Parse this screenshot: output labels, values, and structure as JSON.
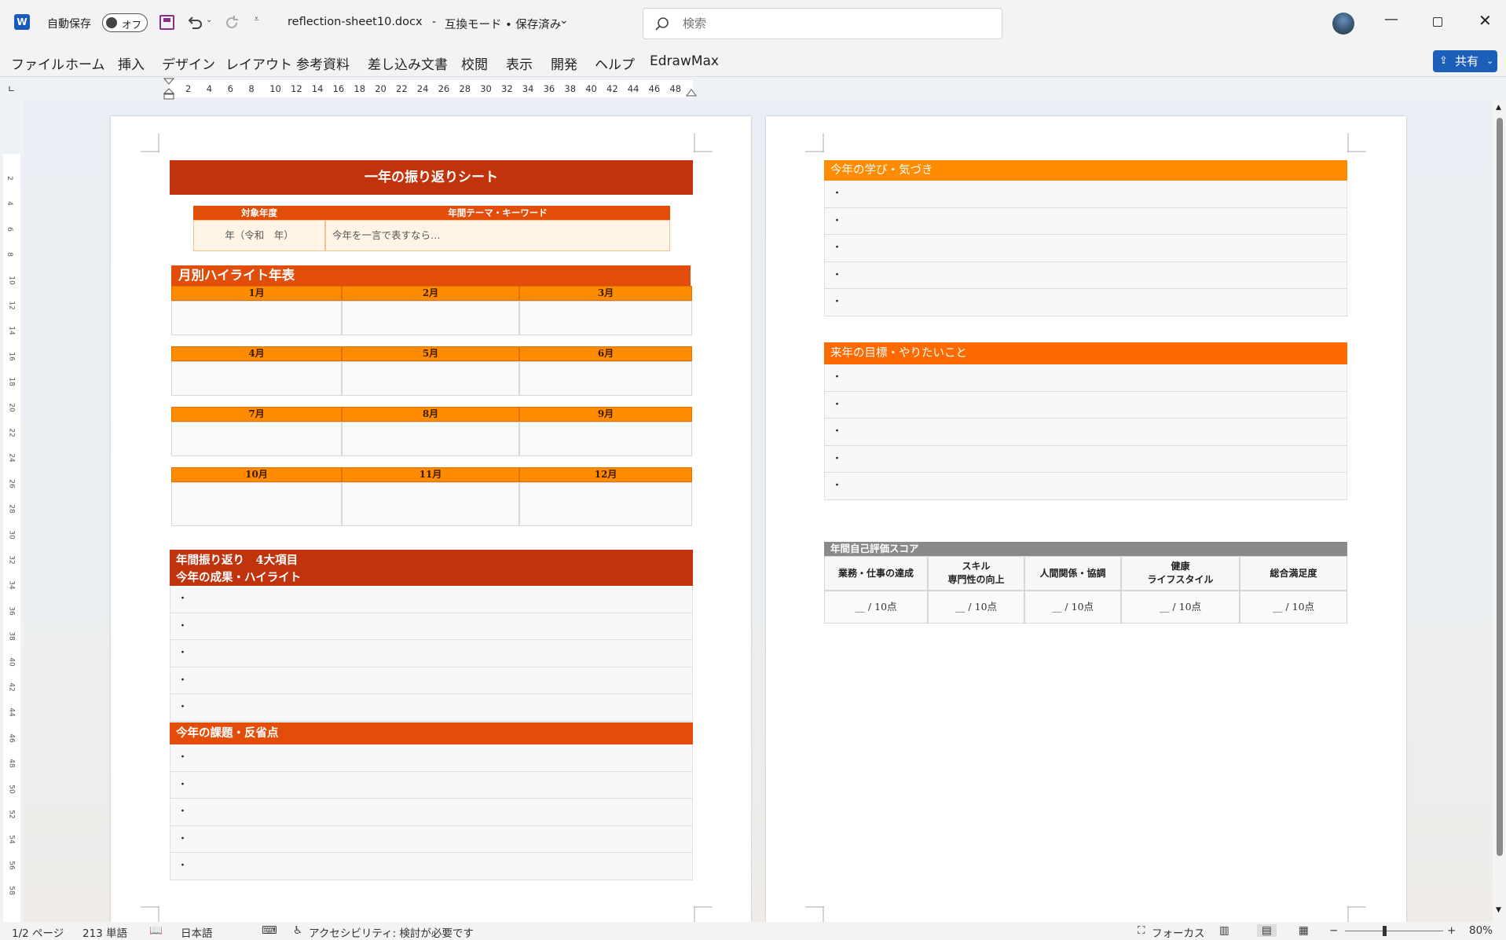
{
  "titlebar": {
    "autosave_label": "自動保存",
    "autosave_state": "オフ",
    "filename": "reflection-sheet10.docx",
    "mode": "互換モード • 保存済み",
    "search_placeholder": "検索"
  },
  "menu": [
    "ファイル",
    "ホーム",
    "挿入",
    "デザイン",
    "レイアウト",
    "参考資料",
    "差し込み文書",
    "校閲",
    "表示",
    "開発",
    "ヘルプ",
    "EdrawMax"
  ],
  "share_label": "共有",
  "ruler_ticks": [
    "2",
    "4",
    "6",
    "8",
    "10",
    "12",
    "14",
    "16",
    "18",
    "20",
    "22",
    "24",
    "26",
    "28",
    "30",
    "32",
    "34",
    "36",
    "38",
    "40",
    "42",
    "44",
    "46",
    "48"
  ],
  "vruler_ticks": [
    "2",
    "4",
    "6",
    "8",
    "10",
    "12",
    "14",
    "16",
    "18",
    "20",
    "22",
    "24",
    "26",
    "28",
    "30",
    "32",
    "34",
    "36",
    "38",
    "40",
    "42",
    "44",
    "46",
    "48",
    "50",
    "52",
    "54",
    "56",
    "58"
  ],
  "page1": {
    "title": "一年の振り返りシート",
    "info_headers": [
      "対象年度",
      "年間テーマ・キーワード"
    ],
    "info_values": [
      "年（令和　年）",
      "今年を一言で表すなら…"
    ],
    "timeline_title": "月別ハイライト年表",
    "months": [
      "1月",
      "2月",
      "3月",
      "4月",
      "5月",
      "6月",
      "7月",
      "8月",
      "9月",
      "10月",
      "11月",
      "12月"
    ],
    "four_title": "年間振り返り　4大項目",
    "achievements_title": "今年の成果・ハイライト",
    "achievements": [
      "・",
      "・",
      "・",
      "・",
      "・"
    ],
    "issues_title": "今年の課題・反省点",
    "issues": [
      "・",
      "・",
      "・",
      "・",
      "・"
    ]
  },
  "page2": {
    "learning_title": "今年の学び・気づき",
    "learning": [
      "・",
      "・",
      "・",
      "・",
      "・"
    ],
    "goals_title": "来年の目標・やりたいこと",
    "goals": [
      "・",
      "・",
      "・",
      "・",
      "・"
    ],
    "score_title": "年間自己評価スコア",
    "score_headers": [
      "業務・仕事の達成",
      "スキル\n専門性の向上",
      "人間関係・協調",
      "健康\nライフスタイル",
      "総合満足度"
    ],
    "score_values": [
      "__ / 10点",
      "__ / 10点",
      "__ / 10点",
      "__ / 10点",
      "__ / 10点"
    ]
  },
  "status": {
    "page": "1/2 ページ",
    "words": "213 単語",
    "language": "日本語",
    "accessibility": "アクセシビリティ: 検討が必要です",
    "focus": "フォーカス",
    "zoom": "80%"
  },
  "colors": {
    "dark_red": "#c0330d",
    "orange_red": "#e84e0a",
    "orange": "#ff8c00",
    "gray": "#8a8a8a"
  }
}
